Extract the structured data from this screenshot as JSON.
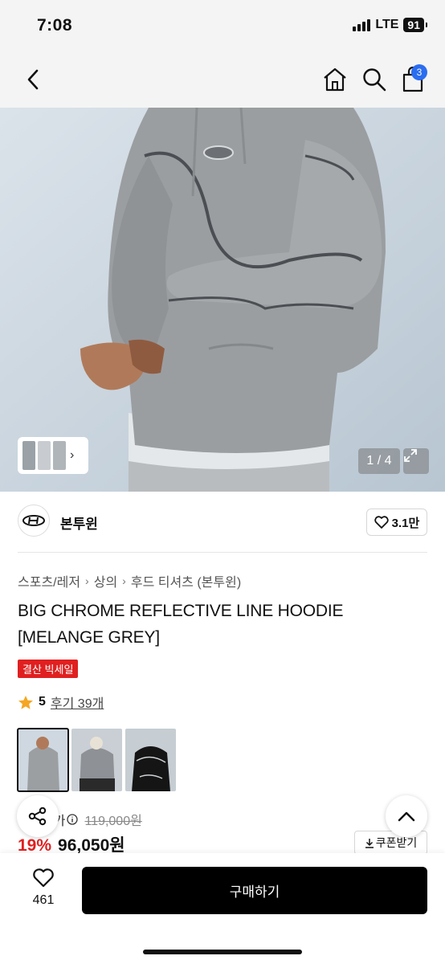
{
  "status": {
    "time": "7:08",
    "network": "LTE",
    "battery": "91"
  },
  "nav": {
    "cart_count": "3"
  },
  "hero": {
    "counter": "1 / 4"
  },
  "brand": {
    "name": "본투윈",
    "likes": "3.1만"
  },
  "breadcrumb": [
    "스포츠/레저",
    "상의",
    "후드 티셔츠 (본투윈)"
  ],
  "product": {
    "title": "BIG CHROME REFLECTIVE LINE HOODIE [MELANGE GREY]",
    "sale_tag": "결산 빅세일",
    "rating": "5",
    "reviews": "후기 39개"
  },
  "price": {
    "label": "정가",
    "original": "119,000원",
    "discount": "19%",
    "final": "96,050원",
    "coupon": "쿠폰받기"
  },
  "bottom": {
    "wish_count": "461",
    "buy_label": "구매하기"
  },
  "colors": {
    "accent": "#2b6df0",
    "sale": "#e02020",
    "button": "#000000"
  },
  "icons": [
    "back-icon",
    "home-icon",
    "search-icon",
    "cart-icon",
    "expand-icon",
    "heart-icon",
    "star-icon",
    "info-icon",
    "download-icon",
    "share-icon",
    "chevron-up-icon"
  ]
}
